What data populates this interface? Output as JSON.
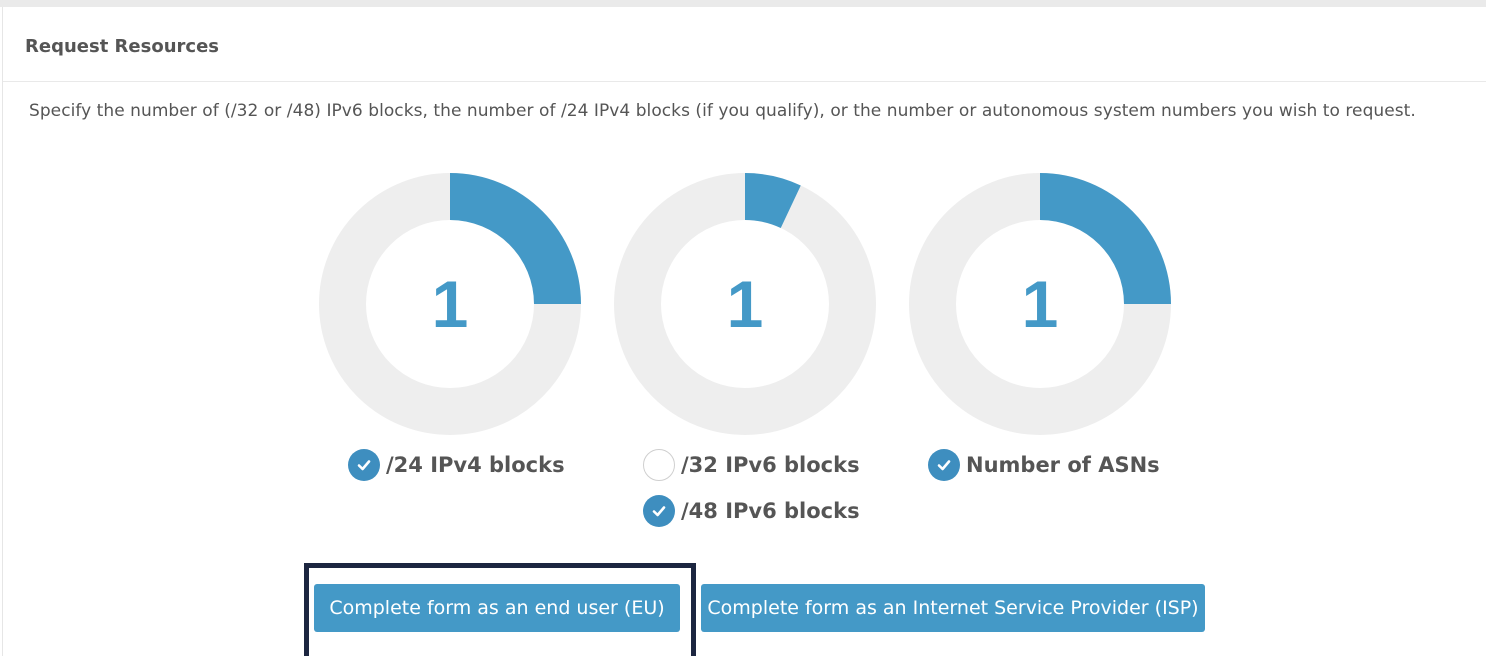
{
  "header": {
    "title": "Request Resources"
  },
  "intro": "Specify the number of (/32 or /48) IPv6 blocks, the number of /24 IPv4 blocks (if you qualify), or the number or autonomous system numbers you wish to request.",
  "colors": {
    "accent": "#4499c7",
    "checkbox": "#3e8ebf",
    "track": "#eeeeee",
    "highlight": "#1c2640"
  },
  "dials": [
    {
      "value": "1",
      "fill_fraction": 0.25
    },
    {
      "value": "1",
      "fill_fraction": 0.07
    },
    {
      "value": "1",
      "fill_fraction": 0.25
    }
  ],
  "options": {
    "ipv4_24": {
      "label": "/24 IPv4 blocks",
      "checked": true
    },
    "ipv6_32": {
      "label": "/32 IPv6 blocks",
      "checked": false
    },
    "ipv6_48": {
      "label": "/48 IPv6 blocks",
      "checked": true
    },
    "asns": {
      "label": "Number of ASNs",
      "checked": true
    }
  },
  "buttons": {
    "eu": "Complete form as an end user (EU)",
    "isp": "Complete form as an Internet Service Provider (ISP)"
  },
  "icons": {
    "checked": "check-circle-icon",
    "unchecked": "empty-circle-icon"
  }
}
